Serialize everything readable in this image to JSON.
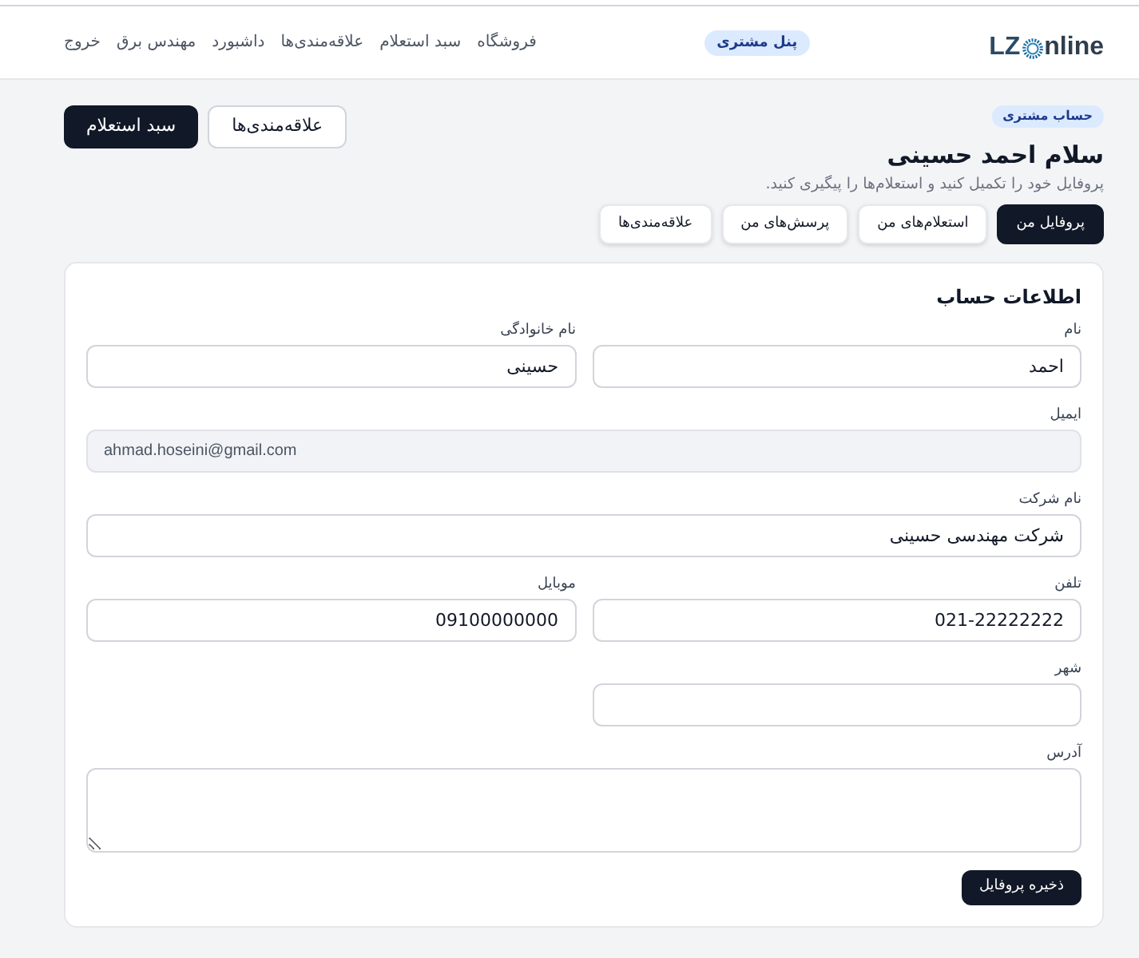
{
  "header": {
    "logo": {
      "text_before": "LZ",
      "text_after": "nline"
    },
    "badge": "پنل مشتری",
    "nav": [
      {
        "label": "فروشگاه"
      },
      {
        "label": "سبد استعلام"
      },
      {
        "label": "علاقه‌مندی‌ها"
      },
      {
        "label": "داشبورد"
      },
      {
        "label": "مهندس برق"
      },
      {
        "label": "خروج"
      }
    ]
  },
  "page_header": {
    "badge": "حساب مشتری",
    "title": "سلام احمد حسینی",
    "subtitle": "پروفایل خود را تکمیل کنید و استعلام‌ها را پیگیری کنید.",
    "actions": [
      {
        "label": "علاقه‌مندی‌ها",
        "kind": "secondary"
      },
      {
        "label": "سبد استعلام",
        "kind": "primary"
      }
    ]
  },
  "tabs": [
    {
      "label": "پروفایل من",
      "selected": true
    },
    {
      "label": "استعلام‌های من",
      "selected": false
    },
    {
      "label": "پرسش‌های من",
      "selected": false
    },
    {
      "label": "علاقه‌مندی‌ها",
      "selected": false
    }
  ],
  "form": {
    "title": "اطلاعات حساب",
    "rows": [
      {
        "fields": [
          {
            "kind": "text",
            "label": "نام",
            "value": "احمد",
            "wide": false,
            "disabled": false
          },
          {
            "kind": "text",
            "label": "نام خانوادگی",
            "value": "حسینی",
            "wide": false,
            "disabled": false
          }
        ]
      },
      {
        "fields": [
          {
            "kind": "email",
            "label": "ایمیل",
            "value": "ahmad.hoseini@gmail.com",
            "wide": true,
            "disabled": true
          }
        ]
      },
      {
        "fields": [
          {
            "kind": "text",
            "label": "نام شرکت",
            "value": "شرکت مهندسی حسینی",
            "wide": true,
            "disabled": false
          }
        ]
      },
      {
        "fields": [
          {
            "kind": "text",
            "label": "تلفن",
            "value": "021-22222222",
            "wide": false,
            "disabled": false
          },
          {
            "kind": "text",
            "label": "موبایل",
            "value": "09100000000",
            "wide": false,
            "disabled": false
          }
        ]
      },
      {
        "fields": [
          {
            "kind": "text",
            "label": "شهر",
            "wide": false,
            "disabled": false
          }
        ]
      },
      {
        "fields": [
          {
            "kind": "textarea",
            "label": "آدرس",
            "wide": true,
            "disabled": false
          }
        ]
      }
    ],
    "submit": "ذخیره پروفایل"
  }
}
